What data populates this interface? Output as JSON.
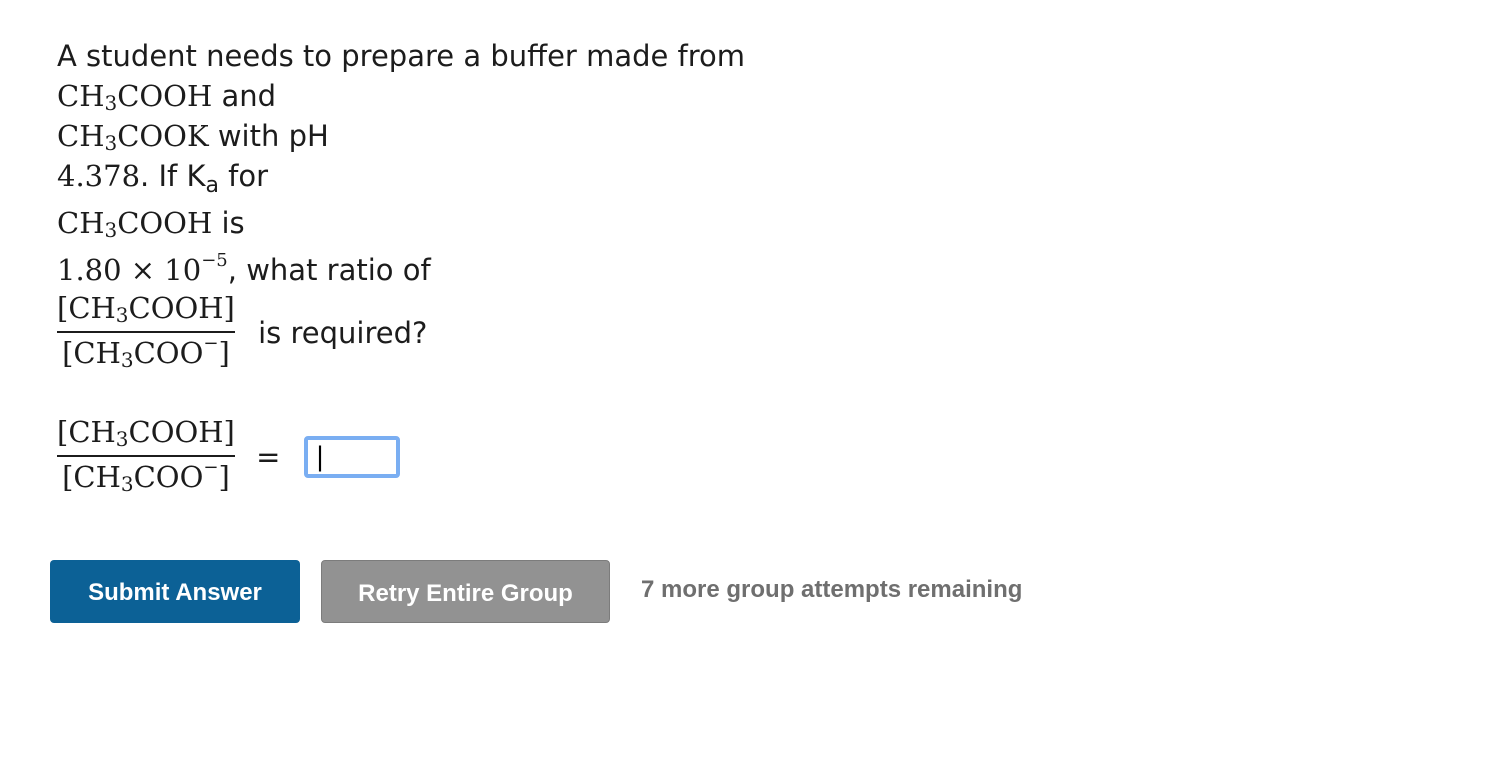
{
  "question": {
    "intro": "A student needs to prepare a buffer made from",
    "acid_formula": {
      "pre": "CH",
      "sub": "3",
      "post": "COOH"
    },
    "and_text": " and",
    "salt_formula": {
      "pre": "CH",
      "sub": "3",
      "post": "COOK"
    },
    "with_ph_text": " with pH",
    "ph_value": "4.378",
    "if_ka_text": ". If K",
    "ka_sub": "a",
    "for_text": " for",
    "acid2_formula": {
      "pre": "CH",
      "sub": "3",
      "post": "COOH"
    },
    "is_text": " is",
    "ka_mantissa": "1.80 × 10",
    "ka_exponent": "−5",
    "what_ratio_text": ", what ratio of",
    "fraction": {
      "num": {
        "pre": "[CH",
        "sub": "3",
        "post": "COOH]"
      },
      "den": {
        "pre": "[CH",
        "sub": "3",
        "post": "COO",
        "sup": "−",
        "close": "]"
      }
    },
    "is_required_text": "is required?"
  },
  "answer": {
    "fraction": {
      "num": {
        "pre": "[CH",
        "sub": "3",
        "post": "COOH]"
      },
      "den": {
        "pre": "[CH",
        "sub": "3",
        "post": "COO",
        "sup": "−",
        "close": "]"
      }
    },
    "equals": "=",
    "input_value": "|"
  },
  "buttons": {
    "submit_label": "Submit Answer",
    "retry_label": "Retry Entire Group"
  },
  "status": {
    "attempts_text": "7 more group attempts remaining"
  },
  "colors": {
    "submit_bg": "#0c6196",
    "retry_bg": "#929292",
    "input_border": "#7aaef2",
    "attempts_text": "#6f6f6f"
  }
}
